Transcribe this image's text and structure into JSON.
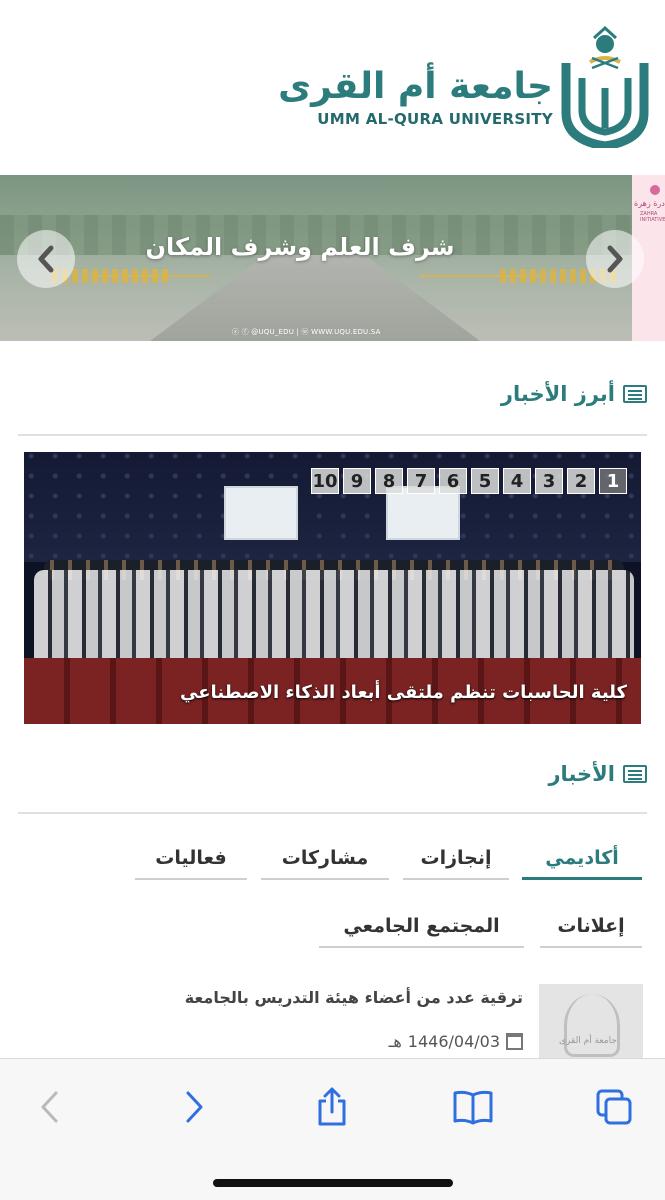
{
  "header": {
    "logo_arabic": "جامعة أم القرى",
    "logo_english": "UMM AL-QURA UNIVERSITY"
  },
  "hero": {
    "title": "شرف العلم وشرف المكان",
    "social_handles": "ⓧ ⓕ @UQU_EDU  |  ⓦ WWW.UQU.EDU.SA",
    "side_banner_text": "مبادرة زهرة",
    "side_banner_sub": "ZAHRA INITIATIVE",
    "prev_icon": "chevron-left-icon",
    "next_icon": "chevron-right-icon"
  },
  "featured_news": {
    "section_title": "أبرز الأخبار",
    "pagination": [
      "1",
      "2",
      "3",
      "4",
      "5",
      "6",
      "7",
      "8",
      "9",
      "10"
    ],
    "active_page": "1",
    "caption": "كلية الحاسبات تنظم ملتقى أبعاد الذكاء الاصطناعي"
  },
  "news": {
    "section_title": "الأخبار",
    "tabs": [
      {
        "label": "أكاديمي",
        "active": true
      },
      {
        "label": "إنجازات",
        "active": false
      },
      {
        "label": "مشاركات",
        "active": false
      },
      {
        "label": "فعاليات",
        "active": false
      },
      {
        "label": "إعلانات",
        "active": false
      },
      {
        "label": "المجتمع الجامعي",
        "active": false
      }
    ],
    "items": [
      {
        "title": "ترقية عدد من أعضاء هيئة التدريس بالجامعة",
        "date": "1446/04/03",
        "date_suffix": "هـ",
        "thumb_text": "جامعة أم القرى"
      }
    ]
  },
  "toolbar": {
    "buttons": [
      "back-icon",
      "forward-icon",
      "share-icon",
      "bookmarks-icon",
      "tabs-icon"
    ]
  },
  "colors": {
    "brand": "#2c7b7d",
    "brand_dark": "#24696b",
    "gold": "#d8b44a"
  }
}
